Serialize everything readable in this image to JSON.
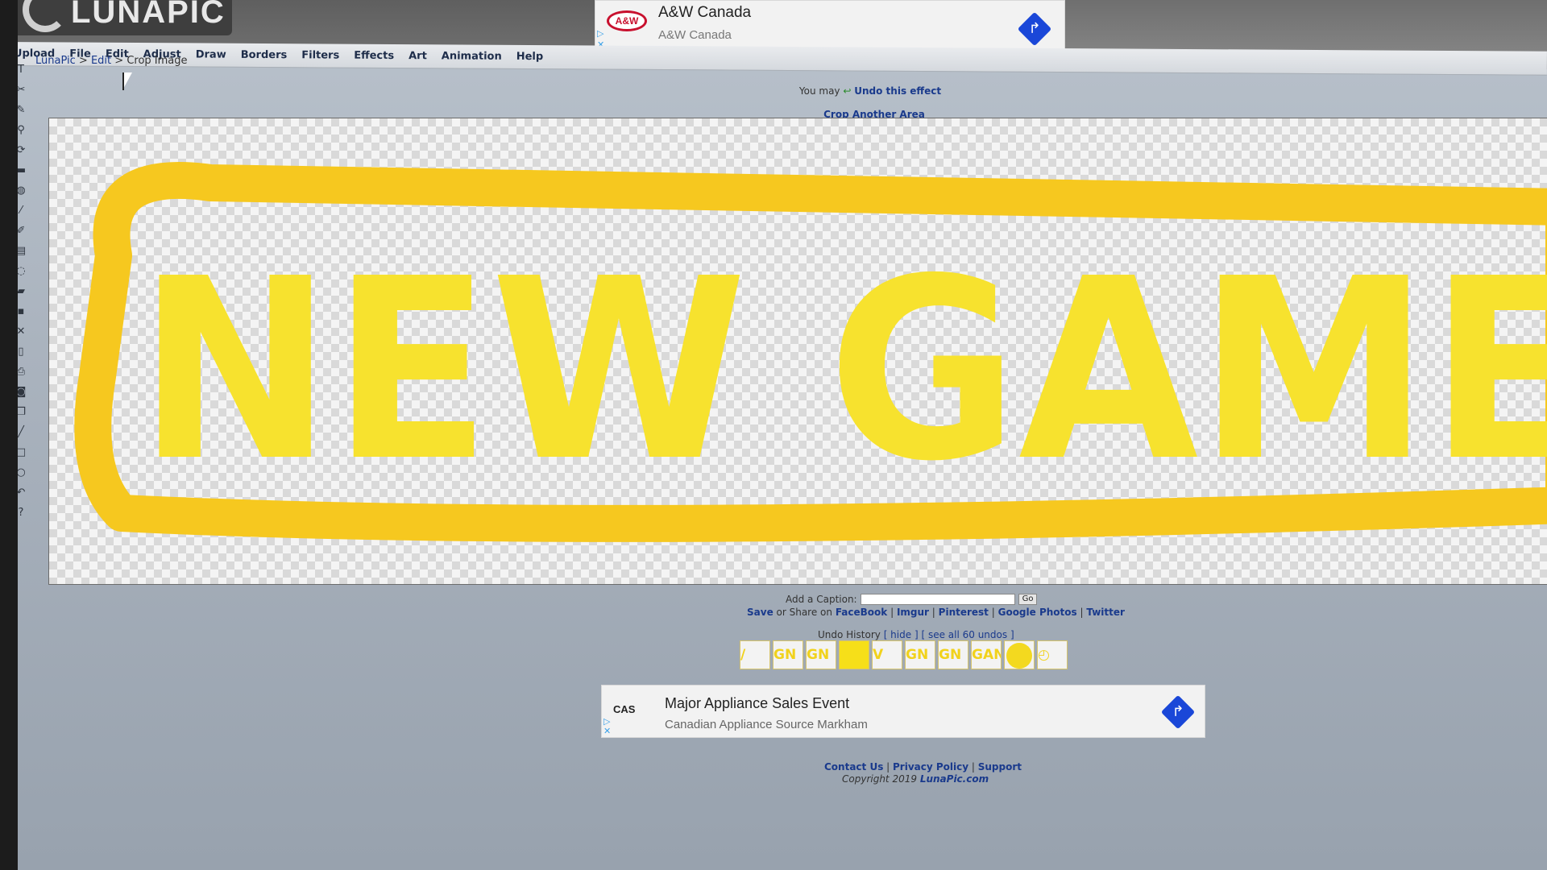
{
  "logo": {
    "text": "LUNAPIC"
  },
  "top_ad": {
    "logo_text": "A&W",
    "title": "A&W Canada",
    "subtitle": "A&W Canada",
    "arrow": "↱"
  },
  "menu": [
    {
      "label": "Upload"
    },
    {
      "label": "File"
    },
    {
      "label": "Edit"
    },
    {
      "label": "Adjust"
    },
    {
      "label": "Draw"
    },
    {
      "label": "Borders"
    },
    {
      "label": "Filters"
    },
    {
      "label": "Effects"
    },
    {
      "label": "Art"
    },
    {
      "label": "Animation"
    },
    {
      "label": "Help"
    }
  ],
  "breadcrumb": {
    "home": "LunaPic",
    "sep1": " > ",
    "edit": "Edit",
    "sep2": " > ",
    "current": "Crop Image"
  },
  "toolbar": [
    {
      "icon": "T",
      "name": "text-tool-icon"
    },
    {
      "icon": "✂",
      "name": "scissors-icon"
    },
    {
      "icon": "✎",
      "name": "pencil-icon"
    },
    {
      "icon": "⚲",
      "name": "zoom-icon"
    },
    {
      "icon": "⟳",
      "name": "rotate-icon"
    },
    {
      "icon": "▬",
      "name": "crop-bar-icon"
    },
    {
      "icon": "◍",
      "name": "bucket-icon"
    },
    {
      "icon": "⁄",
      "name": "eyedropper-icon"
    },
    {
      "icon": "✐",
      "name": "brush-icon"
    },
    {
      "icon": "▤",
      "name": "layers-icon"
    },
    {
      "icon": "◌",
      "name": "eraser-icon"
    },
    {
      "icon": "▰",
      "name": "open-icon"
    },
    {
      "icon": "▪",
      "name": "save-icon"
    },
    {
      "icon": "✕",
      "name": "close-icon"
    },
    {
      "icon": "▯",
      "name": "new-icon"
    },
    {
      "icon": "⎙",
      "name": "print-icon"
    },
    {
      "icon": "◙",
      "name": "camera-icon"
    },
    {
      "icon": "❐",
      "name": "copy-icon"
    },
    {
      "icon": "╱",
      "name": "line-icon"
    },
    {
      "icon": "□",
      "name": "rectangle-icon"
    },
    {
      "icon": "○",
      "name": "circle-icon"
    },
    {
      "icon": "↶",
      "name": "undo-icon"
    },
    {
      "icon": "?",
      "name": "help-icon"
    }
  ],
  "undo_effect": {
    "prefix": "You may ",
    "icon": "↩",
    "link": "Undo this effect"
  },
  "crop_another": "Crop Another Area",
  "canvas_text": "NEW GAME",
  "colors": {
    "yellow": "#f7e22e",
    "orange_frame": "#f6c81f",
    "link": "#1a3a8c"
  },
  "caption": {
    "label": "Add a Caption:",
    "value": "",
    "button": "Go"
  },
  "share": {
    "save": "Save",
    "or_share": " or Share on ",
    "facebook": "FaceBook",
    "imgur": "Imgur",
    "pinterest": "Pinterest",
    "google": "Google Photos",
    "twitter": "Twitter",
    "sep": " | "
  },
  "history": {
    "label": "Undo History",
    "hide": "[ hide ]",
    "see_all": "[ see all 60 undos ]"
  },
  "thumbnails": [
    {
      "kind": "text",
      "text": "/ GN"
    },
    {
      "kind": "text",
      "text": "GN"
    },
    {
      "kind": "text",
      "text": "GN"
    },
    {
      "kind": "solid",
      "text": ""
    },
    {
      "kind": "text",
      "text": "V GN"
    },
    {
      "kind": "text",
      "text": "GN"
    },
    {
      "kind": "text",
      "text": "GN"
    },
    {
      "kind": "text",
      "text": "GAN"
    },
    {
      "kind": "circle",
      "text": ""
    },
    {
      "kind": "text",
      "text": "◴"
    }
  ],
  "bottom_ad": {
    "logo_text": "CAS",
    "title": "Major Appliance Sales Event",
    "subtitle": "Canadian Appliance Source Markham",
    "arrow": "↱"
  },
  "footer": {
    "contact": "Contact Us",
    "privacy": "Privacy Policy",
    "support": "Support",
    "sep": " | "
  },
  "copyright": {
    "prefix": "Copyright 2019 ",
    "site": "LunaPic.com"
  }
}
